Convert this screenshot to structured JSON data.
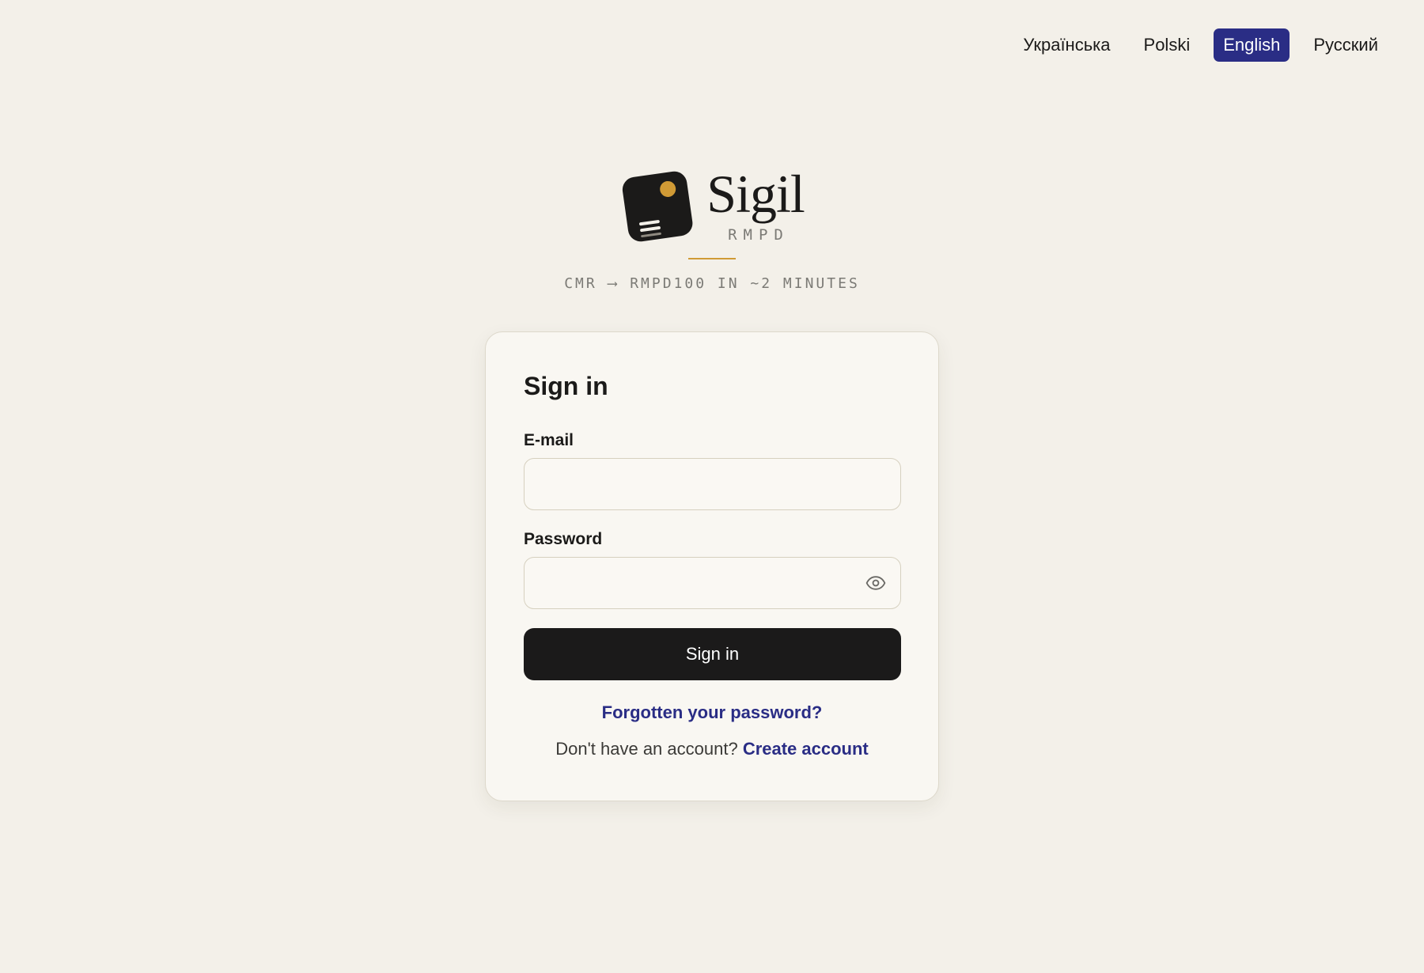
{
  "languages": [
    {
      "label": "Українська",
      "active": false
    },
    {
      "label": "Polski",
      "active": false
    },
    {
      "label": "English",
      "active": true
    },
    {
      "label": "Русский",
      "active": false
    }
  ],
  "brand": {
    "name": "Sigil",
    "sub": "RMPD",
    "tagline": "CMR ⟶ RMPD100 IN ~2 MINUTES",
    "accent_color": "#d09a35",
    "logo_icon": "document-card-icon"
  },
  "signin": {
    "title": "Sign in",
    "email_label": "E-mail",
    "email_value": "",
    "password_label": "Password",
    "password_value": "",
    "password_toggle_icon": "eye-icon",
    "submit_label": "Sign in",
    "forgot_label": "Forgotten your password?",
    "no_account_text": "Don't have an account?",
    "create_account_label": "Create account"
  },
  "colors": {
    "background": "#f3f0e9",
    "primary_button": "#1b1a1a",
    "link": "#2a2d85",
    "active_language": "#2a2d85"
  }
}
